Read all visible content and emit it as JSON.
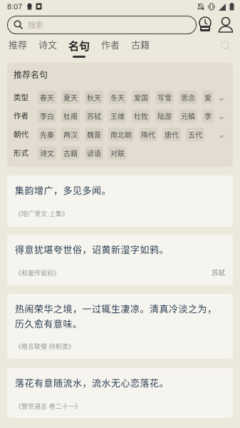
{
  "status": {
    "time": "8:07"
  },
  "search": {
    "placeholder": "搜索"
  },
  "tabs": [
    {
      "label": "推荐",
      "active": false
    },
    {
      "label": "诗文",
      "active": false
    },
    {
      "label": "名句",
      "active": true
    },
    {
      "label": "作者",
      "active": false
    },
    {
      "label": "古籍",
      "active": false
    }
  ],
  "filter": {
    "title": "推荐名句",
    "rows": [
      {
        "label": "类型",
        "chips": [
          "春天",
          "夏天",
          "秋天",
          "冬天",
          "爱国",
          "写雪",
          "思念",
          "爱"
        ]
      },
      {
        "label": "作者",
        "chips": [
          "李白",
          "杜甫",
          "苏轼",
          "王维",
          "杜牧",
          "陆游",
          "元稹",
          "李"
        ]
      },
      {
        "label": "朝代",
        "chips": [
          "先秦",
          "两汉",
          "魏晋",
          "南北朝",
          "隋代",
          "唐代",
          "五代"
        ]
      },
      {
        "label": "形式",
        "chips": [
          "诗文",
          "古籍",
          "谚语",
          "对联"
        ]
      }
    ]
  },
  "quotes": [
    {
      "text": "集韵增广，多见多闻。",
      "source": "《增广贤文·上集》",
      "author": ""
    },
    {
      "text": "得意犹堪夸世俗，诏黄新湿字如鸦。",
      "source": "《和董传留别》",
      "author": "苏轼"
    },
    {
      "text": "热闹荣华之境，一过辄生凄凉。清真冷淡之为，历久愈有意味。",
      "source": "《格言联璧·持躬类》",
      "author": ""
    },
    {
      "text": "落花有意随流水，流水无心恋落花。",
      "source": "《警世通言·卷二十一》",
      "author": ""
    }
  ],
  "colors": {
    "background": "#ece8db",
    "card": "#f6f4ee",
    "quote_text": "#2d3f55"
  }
}
